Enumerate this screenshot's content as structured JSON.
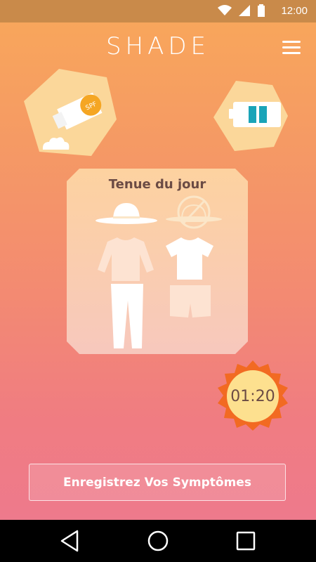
{
  "status_bar": {
    "time": "12:00",
    "icons": [
      "wifi-icon",
      "signal-icon",
      "battery-icon"
    ]
  },
  "app_bar": {
    "brand": "SHADE",
    "menu_icon": "hamburger-menu-icon"
  },
  "tiles": {
    "sunscreen": {
      "icon": "sunscreen-icon",
      "label": "SPF"
    },
    "battery": {
      "icon": "battery-level-icon",
      "level_fraction": 0.35
    }
  },
  "outfit": {
    "title": "Tenue du jour",
    "recommended": [
      "hat-icon",
      "long-sleeve-shirt-icon",
      "long-pants-icon"
    ],
    "not_recommended": [
      "no-hat-icon",
      "tshirt-icon",
      "shorts-icon"
    ]
  },
  "timer": {
    "value": "01:20"
  },
  "actions": {
    "record_symptoms": "Enregistrez Vos Symptômes"
  },
  "nav": {
    "icons": [
      "back-icon",
      "home-icon",
      "recent-apps-icon"
    ]
  },
  "colors": {
    "accent": "#f08a42",
    "teal": "#1aa4b8",
    "text_brown": "#6b4b44"
  }
}
